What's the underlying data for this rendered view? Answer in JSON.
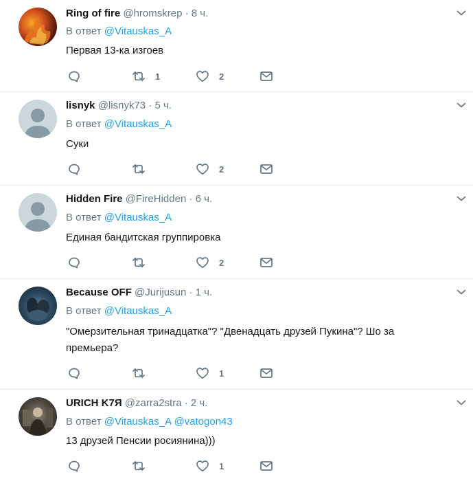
{
  "colors": {
    "link": "#1da1f2",
    "muted": "#657786",
    "text": "#14171a",
    "divider": "#e6ecf0"
  },
  "tweets": [
    {
      "name": "Ring of fire",
      "handle": "@hromskrep",
      "time": "· 8 ч.",
      "reply_prefix": "В ответ",
      "reply_to": "@Vitauskas_A",
      "reply_to2": "",
      "text": "Первая 13-ка изгоев",
      "retweets": "1",
      "likes": "2",
      "avatar": "fire-avatar"
    },
    {
      "name": "lisnyk",
      "handle": "@lisnyk73",
      "time": "· 5 ч.",
      "reply_prefix": "В ответ",
      "reply_to": "@Vitauskas_A",
      "reply_to2": "",
      "text": "Суки",
      "retweets": "",
      "likes": "2",
      "avatar": "default-avatar"
    },
    {
      "name": "Hidden Fire",
      "handle": "@FireHidden",
      "time": "· 6 ч.",
      "reply_prefix": "В ответ",
      "reply_to": "@Vitauskas_A",
      "reply_to2": "",
      "text": "Единая бандитская группировка",
      "retweets": "",
      "likes": "2",
      "avatar": "default-avatar"
    },
    {
      "name": "Because OFF",
      "handle": "@Jurijusun",
      "time": "· 1 ч.",
      "reply_prefix": "В ответ",
      "reply_to": "@Vitauskas_A",
      "reply_to2": "",
      "text": "\"Омерзительная тринадцатка\"? \"Двенадцать друзей Пукина\"? Шо за премьера?",
      "retweets": "",
      "likes": "1",
      "avatar": "photo-avatar"
    },
    {
      "name": "URICH K7Я",
      "handle": "@zarra2stra",
      "time": "· 2 ч.",
      "reply_prefix": "В ответ",
      "reply_to": "@Vitauskas_A",
      "reply_to2": "@vatogon43",
      "text": "13 друзей Пенсии росиянина)))",
      "retweets": "",
      "likes": "1",
      "avatar": "photo-avatar"
    }
  ]
}
